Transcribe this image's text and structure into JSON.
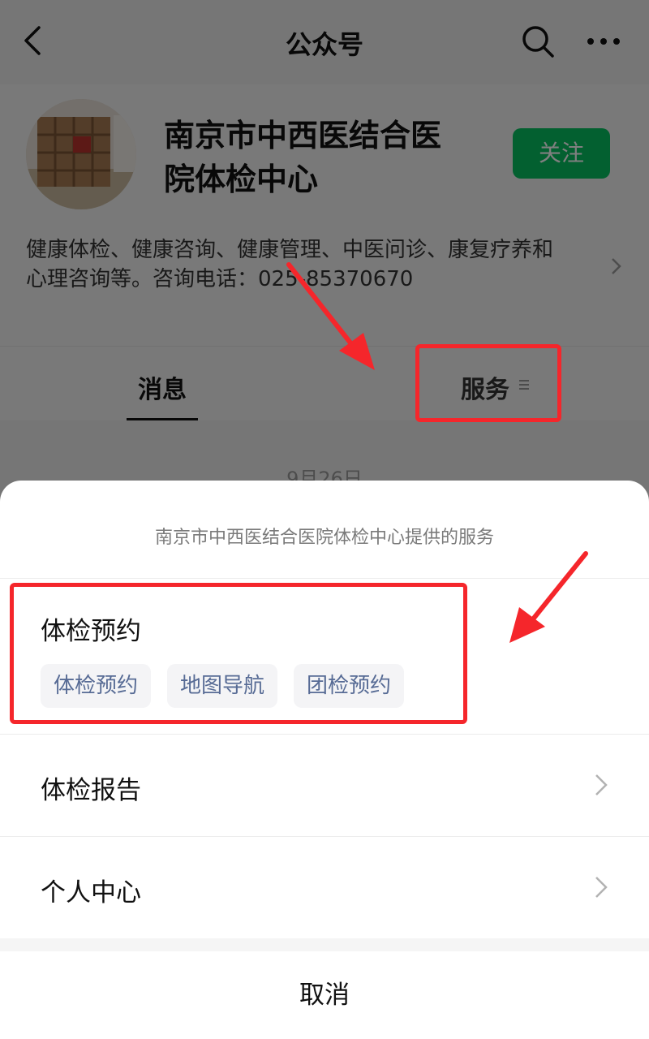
{
  "topbar": {
    "title": "公众号",
    "back_icon": "back-arrow-icon",
    "search_icon": "search-icon",
    "more_icon": "more-dots-icon"
  },
  "profile": {
    "name_line1": "南京市中西医结合医",
    "name_line2": "院体检中心",
    "follow_label": "关注",
    "description_line1": "健康体检、健康咨询、健康管理、中医问诊、康复疗养和",
    "description_line2": "心理咨询等。咨询电话：025-85370670"
  },
  "tabs": {
    "messages_label": "消息",
    "services_label": "服务"
  },
  "feed": {
    "date": "9月26日"
  },
  "sheet": {
    "title": "南京市中西医结合医院体检中心提供的服务",
    "group": {
      "label": "体检预约",
      "chips": [
        "体检预约",
        "地图导航",
        "团检预约"
      ]
    },
    "rows": [
      "体检报告",
      "个人中心"
    ],
    "cancel_label": "取消"
  },
  "colors": {
    "accent_green": "#07c160",
    "chip_text": "#576b95",
    "annotation_red": "#f5262b"
  }
}
